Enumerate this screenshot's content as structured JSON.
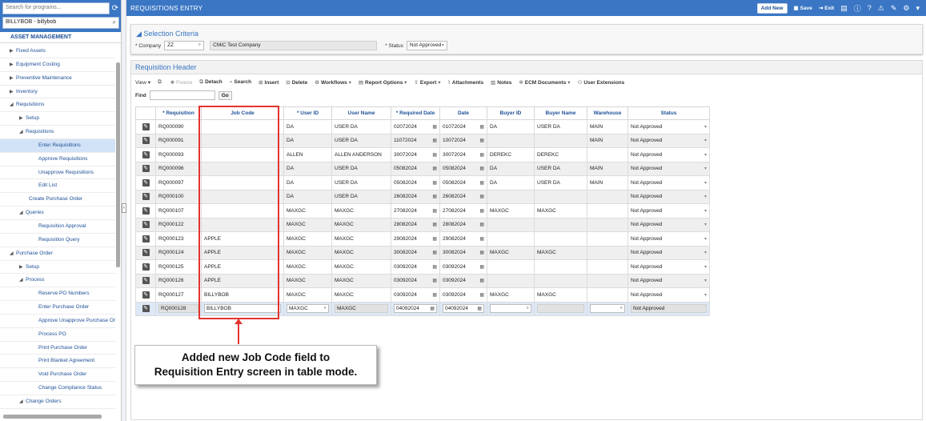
{
  "nav": {
    "program_search_placeholder": "Search for programs...",
    "user_label": "BILLYBOB - billybob",
    "module_title": "ASSET MANAGEMENT",
    "items": [
      {
        "label": "Fixed Assets",
        "level": 1,
        "caret": "right",
        "selected": false
      },
      {
        "label": "Equipment Costing",
        "level": 1,
        "caret": "right",
        "selected": false
      },
      {
        "label": "Preventive Maintenance",
        "level": 1,
        "caret": "right",
        "selected": false
      },
      {
        "label": "Inventory",
        "level": 1,
        "caret": "right",
        "selected": false
      },
      {
        "label": "Requisitions",
        "level": 1,
        "caret": "down",
        "selected": false
      },
      {
        "label": "Setup",
        "level": 2,
        "caret": "right",
        "selected": false
      },
      {
        "label": "Requisitions",
        "level": 2,
        "caret": "down",
        "selected": false
      },
      {
        "label": "Enter Requisitions",
        "level": 3,
        "caret": "",
        "selected": true
      },
      {
        "label": "Approve Requisitions",
        "level": 3,
        "caret": "",
        "selected": false
      },
      {
        "label": "Unapprove Requisitions",
        "level": 3,
        "caret": "",
        "selected": false
      },
      {
        "label": "Edit List",
        "level": 3,
        "caret": "",
        "selected": false
      },
      {
        "label": "Create Purchase Order",
        "level": 2,
        "caret": "",
        "selected": false
      },
      {
        "label": "Queries",
        "level": 2,
        "caret": "down",
        "selected": false
      },
      {
        "label": "Requisition Approval",
        "level": 3,
        "caret": "",
        "selected": false
      },
      {
        "label": "Requisition Query",
        "level": 3,
        "caret": "",
        "selected": false
      },
      {
        "label": "Purchase Order",
        "level": 1,
        "caret": "down",
        "selected": false
      },
      {
        "label": "Setup",
        "level": 2,
        "caret": "right",
        "selected": false
      },
      {
        "label": "Process",
        "level": 2,
        "caret": "down",
        "selected": false
      },
      {
        "label": "Reserve PO Numbers",
        "level": 3,
        "caret": "",
        "selected": false
      },
      {
        "label": "Enter Purchase Order",
        "level": 3,
        "caret": "",
        "selected": false
      },
      {
        "label": "Approve Unapprove Purchase Orc",
        "level": 3,
        "caret": "",
        "selected": false
      },
      {
        "label": "Process PO",
        "level": 3,
        "caret": "",
        "selected": false
      },
      {
        "label": "Print Purchase Order",
        "level": 3,
        "caret": "",
        "selected": false
      },
      {
        "label": "Print Blanket Agreement",
        "level": 3,
        "caret": "",
        "selected": false
      },
      {
        "label": "Void Purchase Order",
        "level": 3,
        "caret": "",
        "selected": false
      },
      {
        "label": "Change Compliance Status",
        "level": 3,
        "caret": "",
        "selected": false
      },
      {
        "label": "Change Orders",
        "level": 2,
        "caret": "down",
        "selected": false
      }
    ]
  },
  "header": {
    "title": "REQUISITIONS ENTRY",
    "add_new": "Add New",
    "save": "Save",
    "exit": "Exit"
  },
  "selection": {
    "title": "Selection Criteria",
    "company_label": "* Company",
    "company_value": "ZZ",
    "company_name": "CMiC Test Company",
    "status_label": "* Status",
    "status_value": "Not Approved"
  },
  "req_header": {
    "title": "Requisition Header",
    "toolbar": {
      "view": "View",
      "freeze": "Freeze",
      "detach": "Detach",
      "search": "Search",
      "insert": "Insert",
      "delete": "Delete",
      "workflows": "Workflows",
      "report_options": "Report Options",
      "export": "Export",
      "attachments": "Attachments",
      "notes": "Notes",
      "ecm_documents": "ECM Documents",
      "user_extensions": "User Extensions"
    },
    "find_label": "Find",
    "go": "Go"
  },
  "grid": {
    "columns": [
      "* Requisition",
      "Job Code",
      "* User ID",
      "User Name",
      "* Required Date",
      "Date",
      "Buyer ID",
      "Buyer Name",
      "Warehouse",
      "Status"
    ],
    "rows": [
      {
        "req": "RQ000090",
        "job": "",
        "user_id": "DA",
        "user_name": "USER DA",
        "req_date": "02072024",
        "date": "01072024",
        "buyer_id": "DA",
        "buyer_name": "USER DA",
        "warehouse": "MAIN",
        "status": "Not Approved"
      },
      {
        "req": "RQ000091",
        "job": "",
        "user_id": "DA",
        "user_name": "USER DA",
        "req_date": "11072024",
        "date": "10072024",
        "buyer_id": "",
        "buyer_name": "",
        "warehouse": "MAIN",
        "status": "Not Approved"
      },
      {
        "req": "RQ000093",
        "job": "",
        "user_id": "ALLEN",
        "user_name": "ALLEN ANDERSON",
        "req_date": "30072024",
        "date": "30072024",
        "buyer_id": "DEREKC",
        "buyer_name": "DEREKC",
        "warehouse": "",
        "status": "Not Approved"
      },
      {
        "req": "RQ000096",
        "job": "",
        "user_id": "DA",
        "user_name": "USER DA",
        "req_date": "05082024",
        "date": "05082024",
        "buyer_id": "DA",
        "buyer_name": "USER DA",
        "warehouse": "MAIN",
        "status": "Not Approved"
      },
      {
        "req": "RQ000097",
        "job": "",
        "user_id": "DA",
        "user_name": "USER DA",
        "req_date": "05082024",
        "date": "05082024",
        "buyer_id": "DA",
        "buyer_name": "USER DA",
        "warehouse": "MAIN",
        "status": "Not Approved"
      },
      {
        "req": "RQ000100",
        "job": "",
        "user_id": "DA",
        "user_name": "USER DA",
        "req_date": "26082024",
        "date": "26082024",
        "buyer_id": "",
        "buyer_name": "",
        "warehouse": "",
        "status": "Not Approved"
      },
      {
        "req": "RQ000107",
        "job": "",
        "user_id": "MAXGC",
        "user_name": "MAXGC",
        "req_date": "27082024",
        "date": "27082024",
        "buyer_id": "MAXGC",
        "buyer_name": "MAXGC",
        "warehouse": "",
        "status": "Not Approved"
      },
      {
        "req": "RQ000122",
        "job": "",
        "user_id": "MAXGC",
        "user_name": "MAXGC",
        "req_date": "28082024",
        "date": "28082024",
        "buyer_id": "",
        "buyer_name": "",
        "warehouse": "",
        "status": "Not Approved"
      },
      {
        "req": "RQ000123",
        "job": "APPLE",
        "user_id": "MAXGC",
        "user_name": "MAXGC",
        "req_date": "29082024",
        "date": "29082024",
        "buyer_id": "",
        "buyer_name": "",
        "warehouse": "",
        "status": "Not Approved"
      },
      {
        "req": "RQ000124",
        "job": "APPLE",
        "user_id": "MAXGC",
        "user_name": "MAXGC",
        "req_date": "30082024",
        "date": "30082024",
        "buyer_id": "MAXGC",
        "buyer_name": "MAXGC",
        "warehouse": "",
        "status": "Not Approved"
      },
      {
        "req": "RQ000125",
        "job": "APPLE",
        "user_id": "MAXGC",
        "user_name": "MAXGC",
        "req_date": "03092024",
        "date": "03092024",
        "buyer_id": "",
        "buyer_name": "",
        "warehouse": "",
        "status": "Not Approved"
      },
      {
        "req": "RQ000126",
        "job": "APPLE",
        "user_id": "MAXGC",
        "user_name": "MAXGC",
        "req_date": "03092024",
        "date": "03092024",
        "buyer_id": "",
        "buyer_name": "",
        "warehouse": "",
        "status": "Not Approved"
      },
      {
        "req": "RQ000127",
        "job": "BILLYBOB",
        "user_id": "MAXGC",
        "user_name": "MAXGC",
        "req_date": "03092024",
        "date": "03092024",
        "buyer_id": "MAXGC",
        "buyer_name": "MAXGC",
        "warehouse": "",
        "status": "Not Approved"
      },
      {
        "req": "RQ000128",
        "job": "BILLYBOB",
        "user_id": "MAXGC",
        "user_name": "MAXGC",
        "req_date": "04092024",
        "date": "04092024",
        "buyer_id": "",
        "buyer_name": "",
        "warehouse": "",
        "status": "Not Approved"
      }
    ]
  },
  "annotation": {
    "line1": "Added new Job Code field to",
    "line2": "Requisition Entry screen in table mode.",
    "color": "#e3342f"
  },
  "colors": {
    "accent": "#3a76c4",
    "link": "#1d4f96"
  }
}
